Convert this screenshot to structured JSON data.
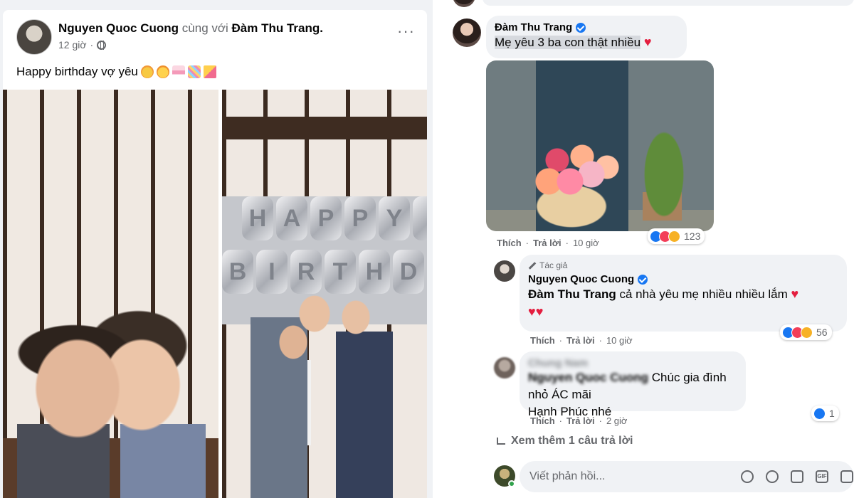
{
  "post": {
    "author": "Nguyen Quoc Cuong",
    "with_text": "cùng với",
    "tagged": "Đàm Thu Trang.",
    "time": "12 giờ",
    "text": "Happy birthday vợ yêu"
  },
  "comments": [
    {
      "name": "Đàm Thu Trang",
      "text": "Mẹ yêu 3 ba con thật nhiều",
      "action_like": "Thích",
      "action_reply": "Trả lời",
      "time": "10 giờ",
      "reaction_count": "123"
    },
    {
      "author_tag": "Tác giả",
      "name": "Nguyen Quoc Cuong",
      "mention": "Đàm Thu Trang",
      "text": "cả nhà yêu mẹ nhiều nhiều lắm",
      "action_like": "Thích",
      "action_reply": "Trả lời",
      "time": "10 giờ",
      "reaction_count": "56"
    },
    {
      "name": "Chung Nam",
      "mention": "Nguyen Quoc Cuong",
      "text_line1": "Chúc gia đình nhỏ ÁC mãi",
      "text_line2": "Hạnh Phúc nhé",
      "action_like": "Thích",
      "action_reply": "Trả lời",
      "time": "2 giờ",
      "reaction_count": "1"
    }
  ],
  "view_more": "Xem thêm 1 câu trả lời",
  "reply_box": {
    "placeholder": "Viết phản hồi..."
  },
  "balloons": "HAPPY BIRTHDAY",
  "colors": {
    "facebook_blue": "#1877f2",
    "heart_red": "#e41e3f",
    "bubble_bg": "#f0f2f5",
    "meta_gray": "#65676b"
  }
}
